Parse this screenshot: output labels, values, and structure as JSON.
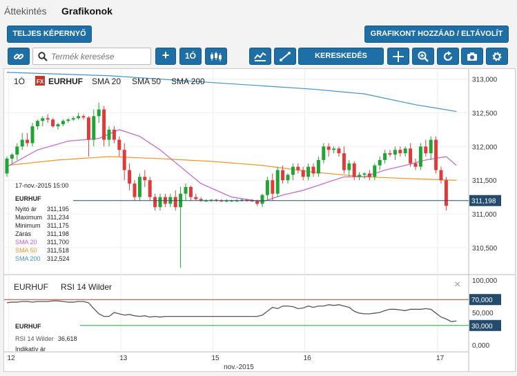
{
  "tabs": [
    {
      "label": "Áttekintés"
    },
    {
      "label": "Grafikonok"
    }
  ],
  "toolbar": {
    "fullscreen_label": "TELJES KÉPERNYŐ",
    "add_chart_label": "GRAFIKONT HOZZÁAD / ELTÁVOLÍT",
    "search_placeholder": "Termék keresése",
    "interval_label": "1Ó",
    "trade_label": "KERESKEDÉS",
    "icons": [
      "link-icon",
      "search-icon",
      "plus-icon",
      "candlestick-icon",
      "indicator-icon",
      "draw-line-icon",
      "crosshair-icon",
      "zoom-icon",
      "refresh-icon",
      "camera-icon",
      "gear-icon"
    ]
  },
  "chart_header": {
    "interval": "1Ó",
    "badge": "FX",
    "symbol": "EURHUF",
    "sma20": "SMA 20",
    "sma50": "SMA 50",
    "sma200": "SMA 200"
  },
  "colors": {
    "accent": "#1d6fa5",
    "bull": "#22a336",
    "bear": "#e03b3b",
    "sma20": "#c45fd0",
    "sma50": "#f0952a",
    "sma200": "#3d93c9",
    "price_line": "#244b6b"
  },
  "info": {
    "date": "17-nov.-2015 15:00",
    "symbol": "EURHUF",
    "rows": [
      {
        "label": "Nyitó ár",
        "value": "311,195"
      },
      {
        "label": "Maximum",
        "value": "311,234"
      },
      {
        "label": "Minimum",
        "value": "311,175"
      },
      {
        "label": "Zárás",
        "value": "311,198"
      },
      {
        "label": "SMA 20",
        "value": "311,700"
      },
      {
        "label": "SMA 50",
        "value": "311,518"
      },
      {
        "label": "SMA 200",
        "value": "312,524"
      }
    ]
  },
  "current_price": "311,198",
  "rsi": {
    "title_symbol": "EURHUF",
    "title_indicator": "RSI 14 Wilder",
    "info_symbol": "EURHUF",
    "info_label": "RSI 14 Wilder",
    "info_value": "36,618",
    "info_footer": "Indikatív ár",
    "level_high": "70,000",
    "level_low": "30,000",
    "close_symbol": "×"
  },
  "chart_data": [
    {
      "type": "candlestick",
      "symbol": "EURHUF",
      "ylim": [
        310.1,
        313.15
      ],
      "y_ticks": [
        "313,000",
        "312,500",
        "312,000",
        "311,500",
        "311,000",
        "310,500"
      ],
      "x_labels": [
        {
          "label": "12",
          "index": 0
        },
        {
          "label": "13",
          "index": 22
        },
        {
          "label": "15",
          "index": 40
        },
        {
          "label": "16",
          "index": 58
        },
        {
          "label": "17",
          "index": 84
        }
      ],
      "x_axis_title": "nov.-2015",
      "candles": [
        [
          311.6,
          311.85,
          311.55,
          311.82
        ],
        [
          311.82,
          311.9,
          311.75,
          311.88
        ],
        [
          311.88,
          312.05,
          311.8,
          312.0
        ],
        [
          312.0,
          312.2,
          311.95,
          312.1
        ],
        [
          312.1,
          312.2,
          312.0,
          312.05
        ],
        [
          312.05,
          312.35,
          312.0,
          312.3
        ],
        [
          312.3,
          312.4,
          312.25,
          312.38
        ],
        [
          312.38,
          312.45,
          312.3,
          312.42
        ],
        [
          312.42,
          312.48,
          312.35,
          312.4
        ],
        [
          312.4,
          312.42,
          312.28,
          312.3
        ],
        [
          312.3,
          312.35,
          312.25,
          312.33
        ],
        [
          312.33,
          312.4,
          312.3,
          312.38
        ],
        [
          312.38,
          312.42,
          312.35,
          312.4
        ],
        [
          312.4,
          312.45,
          312.38,
          312.42
        ],
        [
          312.42,
          312.5,
          312.4,
          312.45
        ],
        [
          312.45,
          312.48,
          312.4,
          312.43
        ],
        [
          312.43,
          312.45,
          311.85,
          312.1
        ],
        [
          312.1,
          312.55,
          312.0,
          312.45
        ],
        [
          312.45,
          312.65,
          312.35,
          312.55
        ],
        [
          312.55,
          312.6,
          312.0,
          312.1
        ],
        [
          312.1,
          312.3,
          312.0,
          312.25
        ],
        [
          312.25,
          312.3,
          312.05,
          312.1
        ],
        [
          312.1,
          312.15,
          311.85,
          311.95
        ],
        [
          311.95,
          312.05,
          311.5,
          311.65
        ],
        [
          311.65,
          311.75,
          311.35,
          311.45
        ],
        [
          311.45,
          311.5,
          311.2,
          311.25
        ],
        [
          311.25,
          311.6,
          311.2,
          311.55
        ],
        [
          311.55,
          311.65,
          311.4,
          311.5
        ],
        [
          311.5,
          311.55,
          311.2,
          311.25
        ],
        [
          311.25,
          311.3,
          311.05,
          311.1
        ],
        [
          311.1,
          311.3,
          311.05,
          311.25
        ],
        [
          311.25,
          311.3,
          311.1,
          311.15
        ],
        [
          311.15,
          311.3,
          311.1,
          311.25
        ],
        [
          311.25,
          311.35,
          311.05,
          311.1
        ],
        [
          311.1,
          311.4,
          310.2,
          311.3
        ],
        [
          311.3,
          311.45,
          311.2,
          311.4
        ],
        [
          311.4,
          311.42,
          311.2,
          311.25
        ],
        [
          311.25,
          311.3,
          311.2,
          311.22
        ],
        [
          311.22,
          311.25,
          311.18,
          311.2
        ],
        [
          311.2,
          311.22,
          311.18,
          311.2
        ],
        [
          311.2,
          311.22,
          311.18,
          311.21
        ],
        [
          311.21,
          311.22,
          311.18,
          311.2
        ],
        [
          311.2,
          311.22,
          311.18,
          311.19
        ],
        [
          311.19,
          311.22,
          311.17,
          311.2
        ],
        [
          311.2,
          311.21,
          311.18,
          311.2
        ],
        [
          311.2,
          311.22,
          311.18,
          311.2
        ],
        [
          311.2,
          311.23,
          311.18,
          311.21
        ],
        [
          311.21,
          311.22,
          311.18,
          311.2
        ],
        [
          311.2,
          311.22,
          311.18,
          311.19
        ],
        [
          311.19,
          311.21,
          311.12,
          311.15
        ],
        [
          311.15,
          311.3,
          311.1,
          311.28
        ],
        [
          311.28,
          311.55,
          311.2,
          311.5
        ],
        [
          311.5,
          311.6,
          311.2,
          311.3
        ],
        [
          311.3,
          311.7,
          311.25,
          311.65
        ],
        [
          311.65,
          311.72,
          311.45,
          311.5
        ],
        [
          311.5,
          311.6,
          311.45,
          311.58
        ],
        [
          311.58,
          311.75,
          311.5,
          311.7
        ],
        [
          311.7,
          311.75,
          311.6,
          311.65
        ],
        [
          311.65,
          311.7,
          311.5,
          311.55
        ],
        [
          311.55,
          311.75,
          311.5,
          311.7
        ],
        [
          311.7,
          311.75,
          311.55,
          311.6
        ],
        [
          311.6,
          311.85,
          311.55,
          311.8
        ],
        [
          311.8,
          312.05,
          311.75,
          312.0
        ],
        [
          312.0,
          312.05,
          311.85,
          311.95
        ],
        [
          311.95,
          312.0,
          311.9,
          311.97
        ],
        [
          311.97,
          312.0,
          311.85,
          311.9
        ],
        [
          311.9,
          312.0,
          311.6,
          311.65
        ],
        [
          311.65,
          311.8,
          311.55,
          311.75
        ],
        [
          311.75,
          311.78,
          311.5,
          311.55
        ],
        [
          311.55,
          311.62,
          311.5,
          311.58
        ],
        [
          311.58,
          311.62,
          311.52,
          311.6
        ],
        [
          311.6,
          311.65,
          311.5,
          311.55
        ],
        [
          311.55,
          311.75,
          311.5,
          311.72
        ],
        [
          311.72,
          311.85,
          311.65,
          311.8
        ],
        [
          311.8,
          311.95,
          311.75,
          311.9
        ],
        [
          311.9,
          311.95,
          311.85,
          311.88
        ],
        [
          311.88,
          312.0,
          311.8,
          311.95
        ],
        [
          311.95,
          312.0,
          311.85,
          311.9
        ],
        [
          311.9,
          312.0,
          311.85,
          311.97
        ],
        [
          311.97,
          312.05,
          311.7,
          311.75
        ],
        [
          311.75,
          311.82,
          311.65,
          311.7
        ],
        [
          311.7,
          312.05,
          311.65,
          312.0
        ],
        [
          312.0,
          312.1,
          311.85,
          311.9
        ],
        [
          311.9,
          312.15,
          311.8,
          312.1
        ],
        [
          312.1,
          312.15,
          311.6,
          311.65
        ],
        [
          311.65,
          311.7,
          311.45,
          311.5
        ],
        [
          311.5,
          311.55,
          311.05,
          311.12
        ]
      ],
      "sma20": [
        [
          0,
          311.7
        ],
        [
          6,
          311.95
        ],
        [
          12,
          312.08
        ],
        [
          18,
          312.12
        ],
        [
          22,
          312.25
        ],
        [
          26,
          312.15
        ],
        [
          30,
          311.95
        ],
        [
          34,
          311.7
        ],
        [
          38,
          311.45
        ],
        [
          44,
          311.25
        ],
        [
          50,
          311.18
        ],
        [
          54,
          311.28
        ],
        [
          58,
          311.35
        ],
        [
          62,
          311.45
        ],
        [
          66,
          311.55
        ],
        [
          70,
          311.55
        ],
        [
          74,
          311.65
        ],
        [
          78,
          311.72
        ],
        [
          82,
          311.8
        ],
        [
          86,
          311.85
        ],
        [
          88,
          311.72
        ]
      ],
      "sma50": [
        [
          0,
          311.72
        ],
        [
          10,
          311.8
        ],
        [
          20,
          311.85
        ],
        [
          30,
          311.82
        ],
        [
          40,
          311.78
        ],
        [
          50,
          311.72
        ],
        [
          60,
          311.62
        ],
        [
          70,
          311.55
        ],
        [
          80,
          311.52
        ],
        [
          88,
          311.5
        ]
      ],
      "sma200": [
        [
          0,
          313.1
        ],
        [
          20,
          313.05
        ],
        [
          40,
          312.95
        ],
        [
          60,
          312.85
        ],
        [
          70,
          312.78
        ],
        [
          80,
          312.62
        ],
        [
          88,
          312.52
        ]
      ]
    },
    {
      "type": "line",
      "indicator": "RSI 14 Wilder",
      "ylim": [
        0,
        100
      ],
      "y_ticks": [
        "100,000",
        "50,000",
        "0,000"
      ],
      "levels": [
        70,
        30
      ],
      "values": [
        65,
        66,
        66,
        67,
        67,
        66,
        67,
        67,
        67,
        68,
        68,
        67,
        66,
        66,
        67,
        67,
        65,
        56,
        48,
        44,
        44,
        50,
        48,
        46,
        47,
        45,
        44,
        45,
        43,
        44,
        43,
        44,
        44,
        44,
        44,
        44,
        44,
        44,
        44,
        44,
        44,
        44,
        44,
        44,
        44,
        44,
        44,
        44,
        44,
        44,
        46,
        52,
        58,
        56,
        60,
        60,
        59,
        56,
        57,
        60,
        58,
        60,
        60,
        62,
        61,
        62,
        60,
        58,
        52,
        49,
        48,
        48,
        49,
        50,
        53,
        55,
        55,
        54,
        53,
        55,
        55,
        55,
        56,
        55,
        49,
        43,
        40,
        36,
        37
      ]
    }
  ]
}
